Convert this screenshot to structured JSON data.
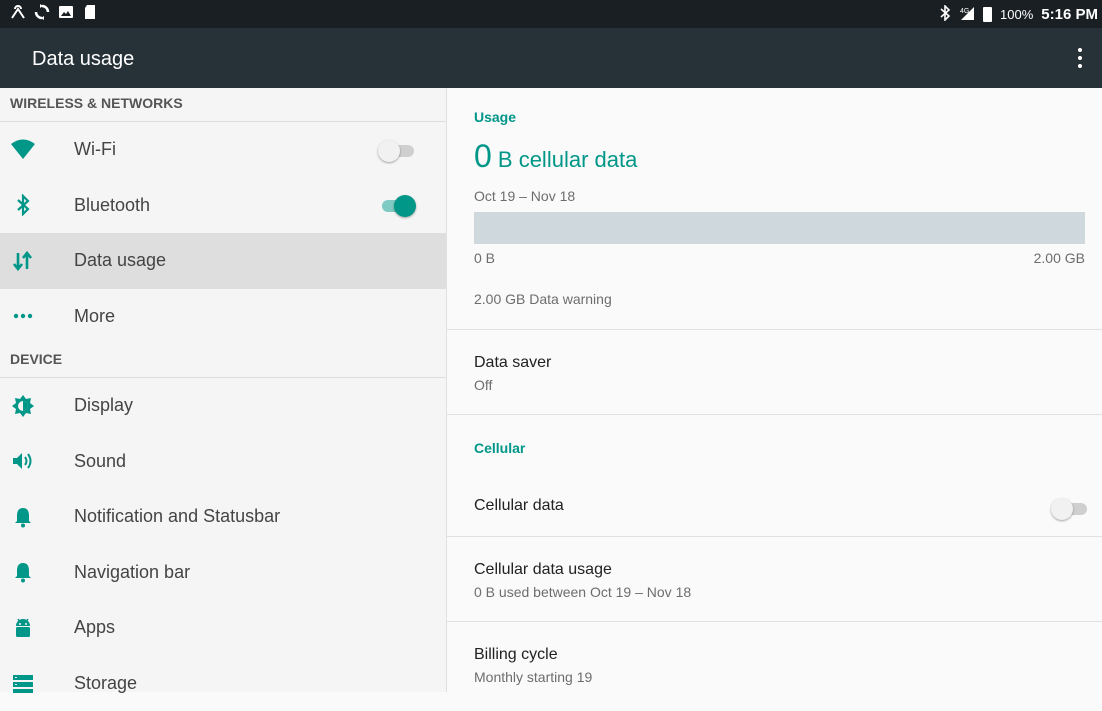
{
  "statusbar": {
    "icons_left": [
      "notification-icon",
      "sync-icon",
      "image-icon",
      "sd-card-icon"
    ],
    "battery": "100%",
    "time": "5:16 PM"
  },
  "appbar": {
    "title": "Data usage"
  },
  "sidebar": {
    "wireless_header": "WIRELESS & NETWORKS",
    "wifi": {
      "label": "Wi-Fi",
      "toggle": "off"
    },
    "bluetooth": {
      "label": "Bluetooth",
      "toggle": "on"
    },
    "data_usage": {
      "label": "Data usage"
    },
    "more": {
      "label": "More"
    },
    "device_header": "DEVICE",
    "display": {
      "label": "Display"
    },
    "sound": {
      "label": "Sound"
    },
    "notification": {
      "label": "Notification and Statusbar"
    },
    "navigation": {
      "label": "Navigation bar"
    },
    "apps": {
      "label": "Apps"
    },
    "storage": {
      "label": "Storage"
    }
  },
  "main": {
    "usage_header": "Usage",
    "amount_num": "0",
    "amount_rest": " B cellular data",
    "period": "Oct 19 – Nov 18",
    "usage_fraction": 0,
    "bar_min": "0 B",
    "bar_max": "2.00 GB",
    "warning": "2.00 GB Data warning",
    "data_saver": {
      "title": "Data saver",
      "value": "Off"
    },
    "cellular_header": "Cellular",
    "cellular_data": {
      "title": "Cellular data",
      "toggle": "off"
    },
    "cellular_usage": {
      "title": "Cellular data usage",
      "value": "0 B used between Oct 19 – Nov 18"
    },
    "billing": {
      "title": "Billing cycle",
      "value": "Monthly starting 19"
    }
  },
  "colors": {
    "accent": "#009688",
    "appbar": "#263238",
    "statusbar": "#1a1f23"
  }
}
